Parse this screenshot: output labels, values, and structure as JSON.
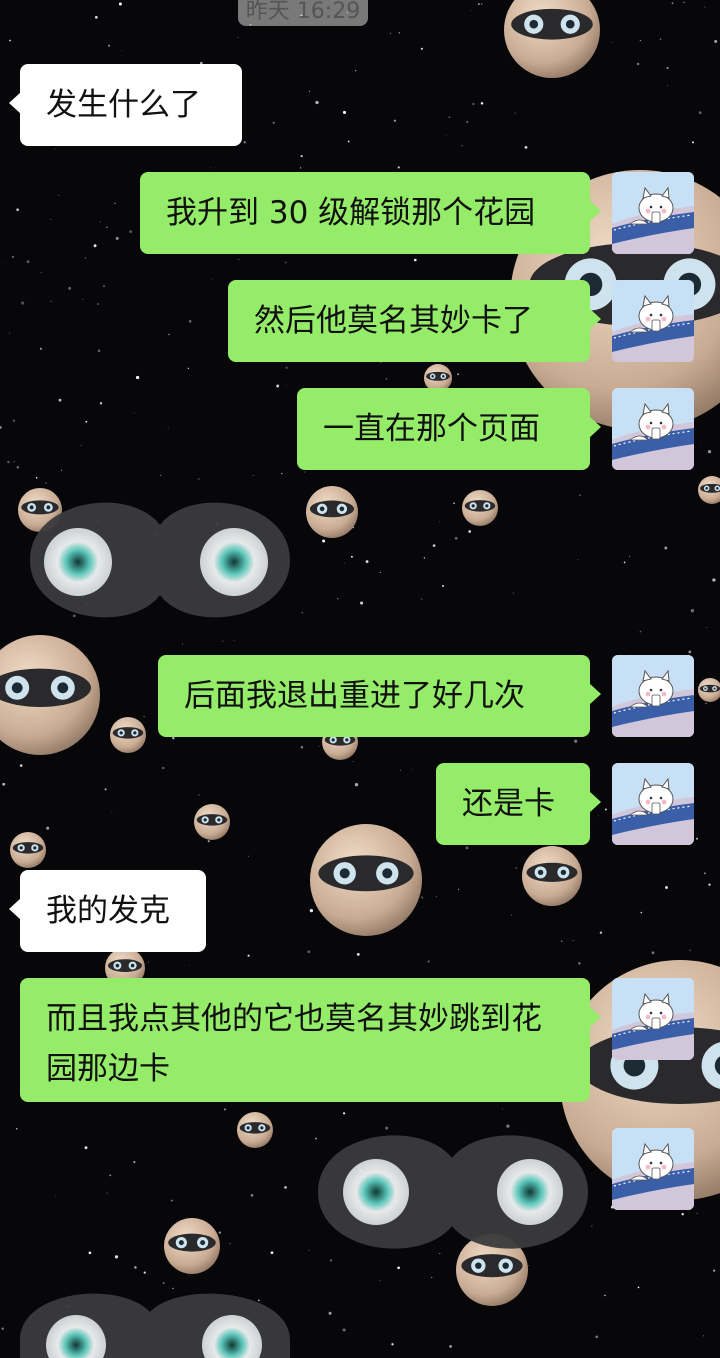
{
  "timestamp": "昨天 16:29",
  "colors": {
    "sent_bubble": "#95ec69",
    "received_bubble": "#ffffff",
    "background": "#07070a"
  },
  "messages": [
    {
      "side": "received",
      "text": "发生什么了"
    },
    {
      "side": "sent",
      "text": "我升到 30 级解锁那个花园"
    },
    {
      "side": "sent",
      "text": "然后他莫名其妙卡了"
    },
    {
      "side": "sent",
      "text": "一直在那个页面"
    },
    {
      "side": "sent",
      "type": "sticker",
      "icon": "eyes-mask-sticker"
    },
    {
      "side": "sent",
      "text": "后面我退出重进了好几次"
    },
    {
      "side": "sent",
      "text": "还是卡"
    },
    {
      "side": "received",
      "text": "我的发克"
    },
    {
      "side": "sent",
      "text": "而且我点其他的它也莫名其妙跳到花园那边卡"
    },
    {
      "side": "sent",
      "type": "sticker",
      "icon": "eyes-mask-sticker"
    }
  ]
}
